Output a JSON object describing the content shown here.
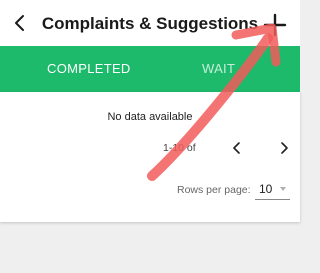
{
  "header": {
    "title": "Complaints & Suggestions",
    "back_icon": "chevron-left-icon",
    "add_icon": "plus-icon"
  },
  "tabs": [
    {
      "label": "COMPLETED",
      "active": true
    },
    {
      "label": "WAIT",
      "active": false
    }
  ],
  "table": {
    "empty_message": "No data available",
    "pagination": {
      "range_text": "1-10 of",
      "prev_icon": "chevron-left-icon",
      "next_icon": "chevron-right-icon"
    },
    "rows_per_page": {
      "label": "Rows per page:",
      "value": "10"
    }
  },
  "colors": {
    "tab_bar": "#1dba6b",
    "annotation_arrow": "#f25a5a"
  }
}
